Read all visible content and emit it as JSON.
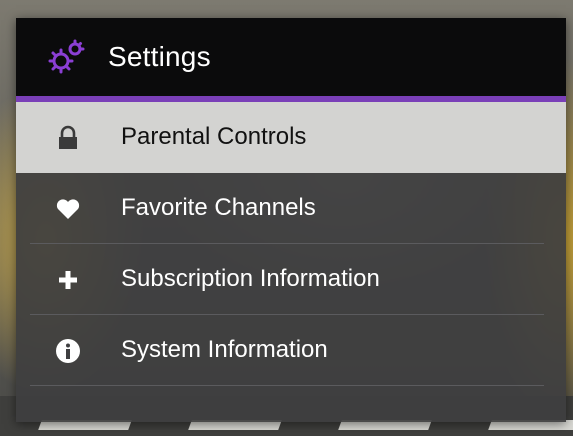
{
  "menu": {
    "title": "Settings",
    "header_icon": "gears-icon",
    "accent_color": "#7a3fb8",
    "items": [
      {
        "label": "Parental Controls",
        "icon": "lock-icon",
        "selected": true
      },
      {
        "label": "Favorite Channels",
        "icon": "heart-icon",
        "selected": false
      },
      {
        "label": "Subscription Information",
        "icon": "plus-icon",
        "selected": false
      },
      {
        "label": "System Information",
        "icon": "info-icon",
        "selected": false
      }
    ]
  }
}
